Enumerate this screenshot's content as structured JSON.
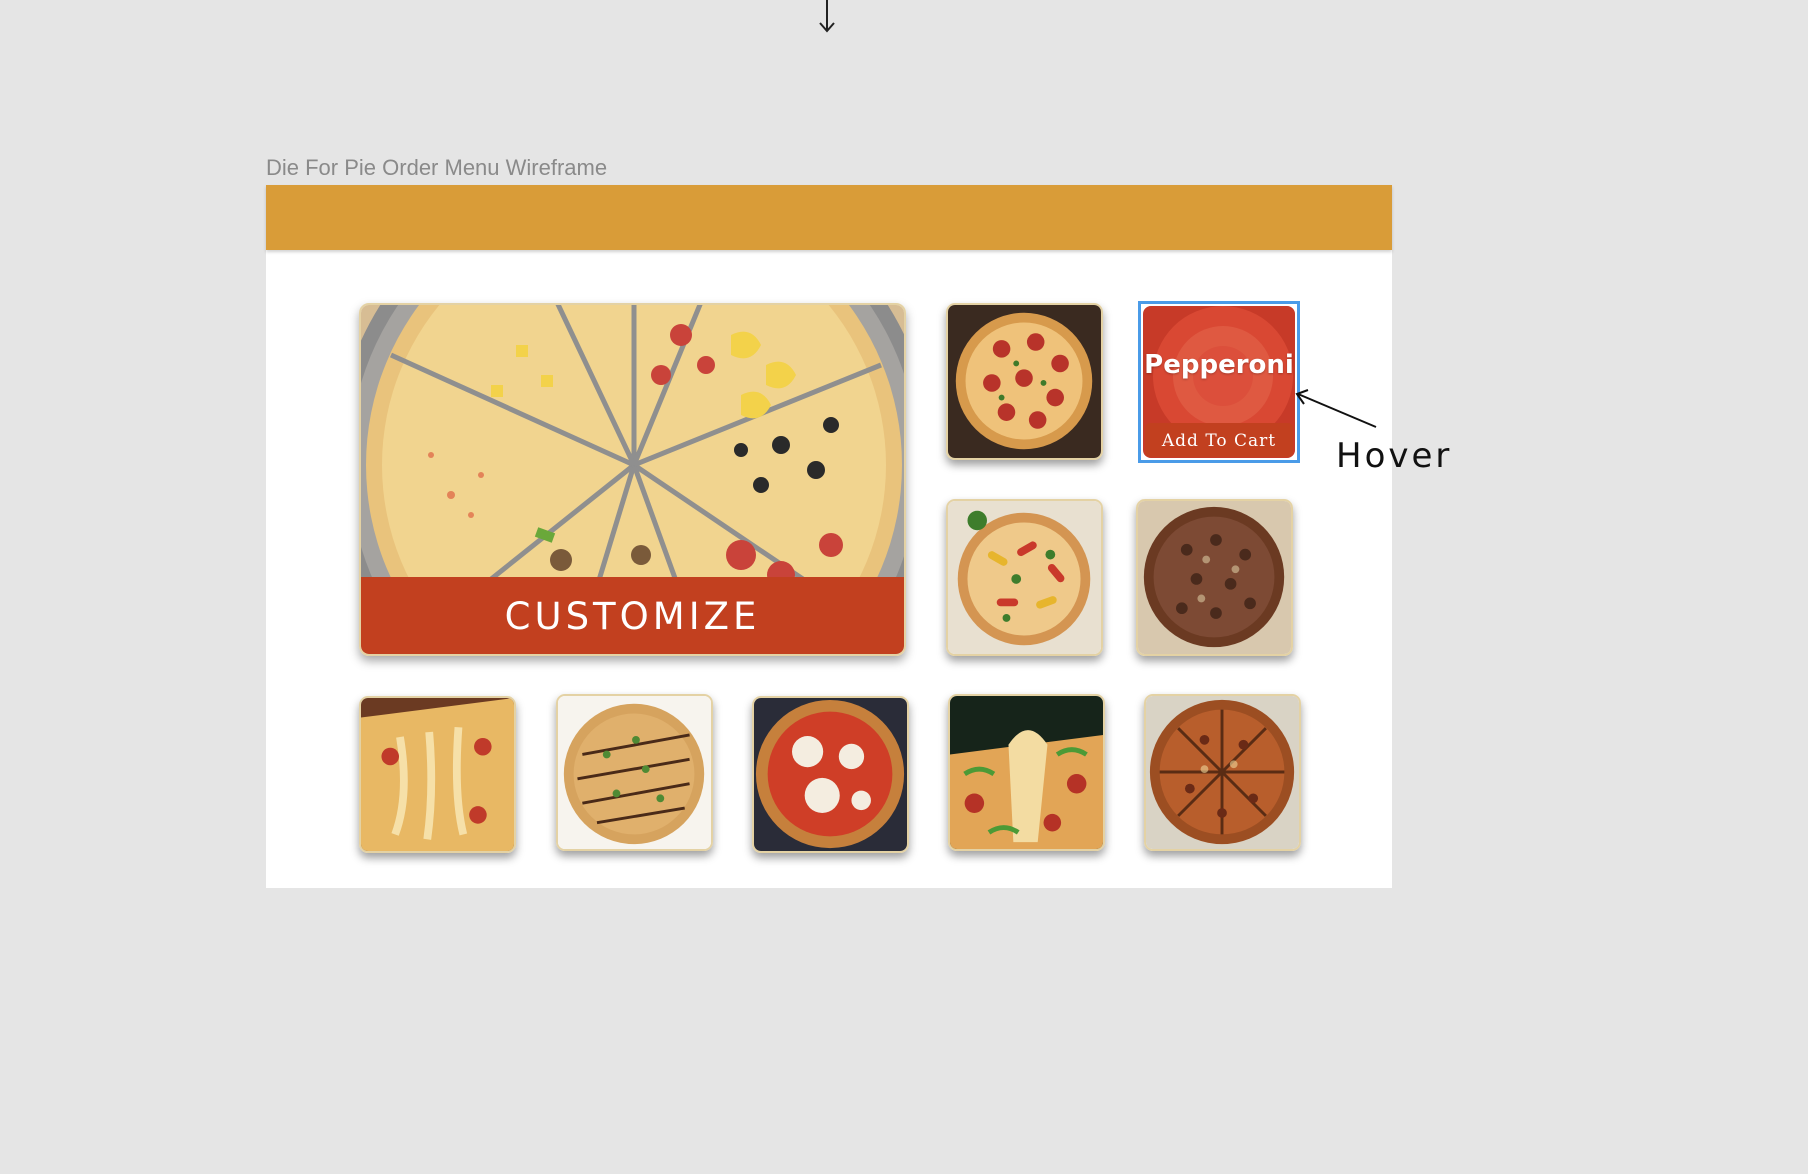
{
  "frame": {
    "title": "Die For Pie Order Menu Wireframe"
  },
  "colors": {
    "canvas": "#e5e5e5",
    "header_bar": "#d99c38",
    "accent_red": "#c2401f",
    "selection_blue": "#4a9be8",
    "tile_border": "#e4d2a4"
  },
  "feature": {
    "button_label": "CUSTOMIZE",
    "image_icon": "combo-pizza-image"
  },
  "hovered_item": {
    "name": "Pepperoni",
    "button_label": "Add To Cart",
    "image_icon": "pepperoni-image"
  },
  "annotation": {
    "label": "Hover"
  },
  "menu_items": [
    {
      "image_icon": "pepperoni-pizza-image"
    },
    {
      "image_icon": "veggie-pizza-image"
    },
    {
      "image_icon": "sausage-pizza-image"
    },
    {
      "image_icon": "cheesy-slice-pizza-image"
    },
    {
      "image_icon": "bbq-chicken-pizza-image"
    },
    {
      "image_icon": "margherita-pizza-image"
    },
    {
      "image_icon": "pepper-slice-pizza-image"
    },
    {
      "image_icon": "supreme-pizza-image"
    }
  ]
}
